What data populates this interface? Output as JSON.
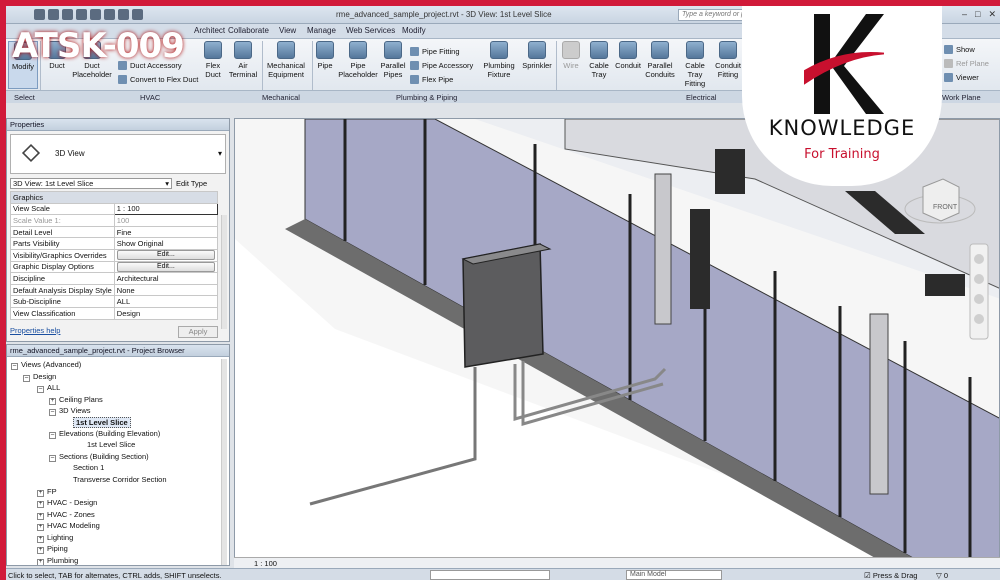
{
  "badge": {
    "text": "ATSK-009"
  },
  "logo": {
    "word": "KNOWLEDGE",
    "tagline": "For Training",
    "colors": {
      "red": "#c8102e",
      "black": "#111111"
    }
  },
  "titlebar": {
    "title": "rme_advanced_sample_project.rvt - 3D View: 1st Level Slice",
    "search_placeholder": "Type a keyword or phrase",
    "qat_icons": [
      "open-icon",
      "save-icon",
      "undo-icon",
      "redo-icon",
      "measure-icon",
      "text-icon",
      "3d-view-icon",
      "section-icon"
    ]
  },
  "tabs": [
    "Architect",
    "Collaborate",
    "View",
    "Manage",
    "Web Services",
    "Modify"
  ],
  "ribbon": {
    "modify": "Modify",
    "hvac": {
      "duct": "Duct",
      "duct_placeholder": "Duct Placeholder",
      "duct_fitting": "Duct Fitting",
      "duct_accessory": "Duct Accessory",
      "convert_flex": "Convert to Flex Duct",
      "flex_duct": "Flex Duct",
      "air_terminal": "Air Terminal"
    },
    "mechanical": {
      "equipment": "Mechanical Equipment"
    },
    "plumbing": {
      "pipe": "Pipe",
      "pipe_placeholder": "Pipe Placeholder",
      "parallel_pipes": "Parallel Pipes",
      "pipe_fitting": "Pipe Fitting",
      "pipe_accessory": "Pipe Accessory",
      "flex_pipe": "Flex Pipe",
      "plumbing_fixture": "Plumbing Fixture",
      "sprinkler": "Sprinkler"
    },
    "electrical": {
      "wire": "Wire",
      "cable_tray": "Cable Tray",
      "conduit": "Conduit",
      "parallel_conduits": "Parallel Conduits",
      "cable_tray_fitting": "Cable Tray Fitting",
      "conduit_fitting": "Conduit Fitting"
    },
    "workplane": {
      "show": "Show",
      "ref_plane": "Ref Plane",
      "viewer": "Viewer"
    },
    "panels": {
      "select": "Select",
      "hvac": "HVAC",
      "mechanical": "Mechanical",
      "plumbing": "Plumbing & Piping",
      "electrical": "Electrical",
      "workplane": "Work Plane"
    }
  },
  "properties": {
    "header": "Properties",
    "type_name": "3D View",
    "instance": "3D View: 1st Level Slice",
    "edit_type": "Edit Type",
    "group": "Graphics",
    "rows": [
      {
        "k": "View Scale",
        "v": "1 : 100"
      },
      {
        "k": "Scale Value    1:",
        "v": "100"
      },
      {
        "k": "Detail Level",
        "v": "Fine"
      },
      {
        "k": "Parts Visibility",
        "v": "Show Original"
      },
      {
        "k": "Visibility/Graphics Overrides",
        "v": "Edit..."
      },
      {
        "k": "Graphic Display Options",
        "v": "Edit..."
      },
      {
        "k": "Discipline",
        "v": "Architectural"
      },
      {
        "k": "Default Analysis Display Style",
        "v": "None"
      },
      {
        "k": "Sub-Discipline",
        "v": "ALL"
      },
      {
        "k": "View Classification",
        "v": "Design"
      }
    ],
    "help": "Properties help",
    "apply": "Apply"
  },
  "browser": {
    "header": "rme_advanced_sample_project.rvt - Project Browser",
    "items": [
      "Views (Advanced)",
      "Design",
      "ALL",
      "Ceiling Plans",
      "3D Views",
      "1st Level Slice",
      "Elevations (Building Elevation)",
      "1st Level Slice",
      "Sections (Building Section)",
      "Section 1",
      "Transverse Corridor Section",
      "FP",
      "HVAC - Design",
      "HVAC - Zones",
      "HVAC Modeling",
      "Lighting",
      "Piping",
      "Plumbing"
    ]
  },
  "viewport": {
    "scale": "1 : 100",
    "viewcube_face": "FRONT"
  },
  "status": {
    "message": "Click to select, TAB for alternates, CTRL adds, SHIFT unselects.",
    "model": "Main Model",
    "press_drag": "Press & Drag",
    "filter_count": "0"
  }
}
